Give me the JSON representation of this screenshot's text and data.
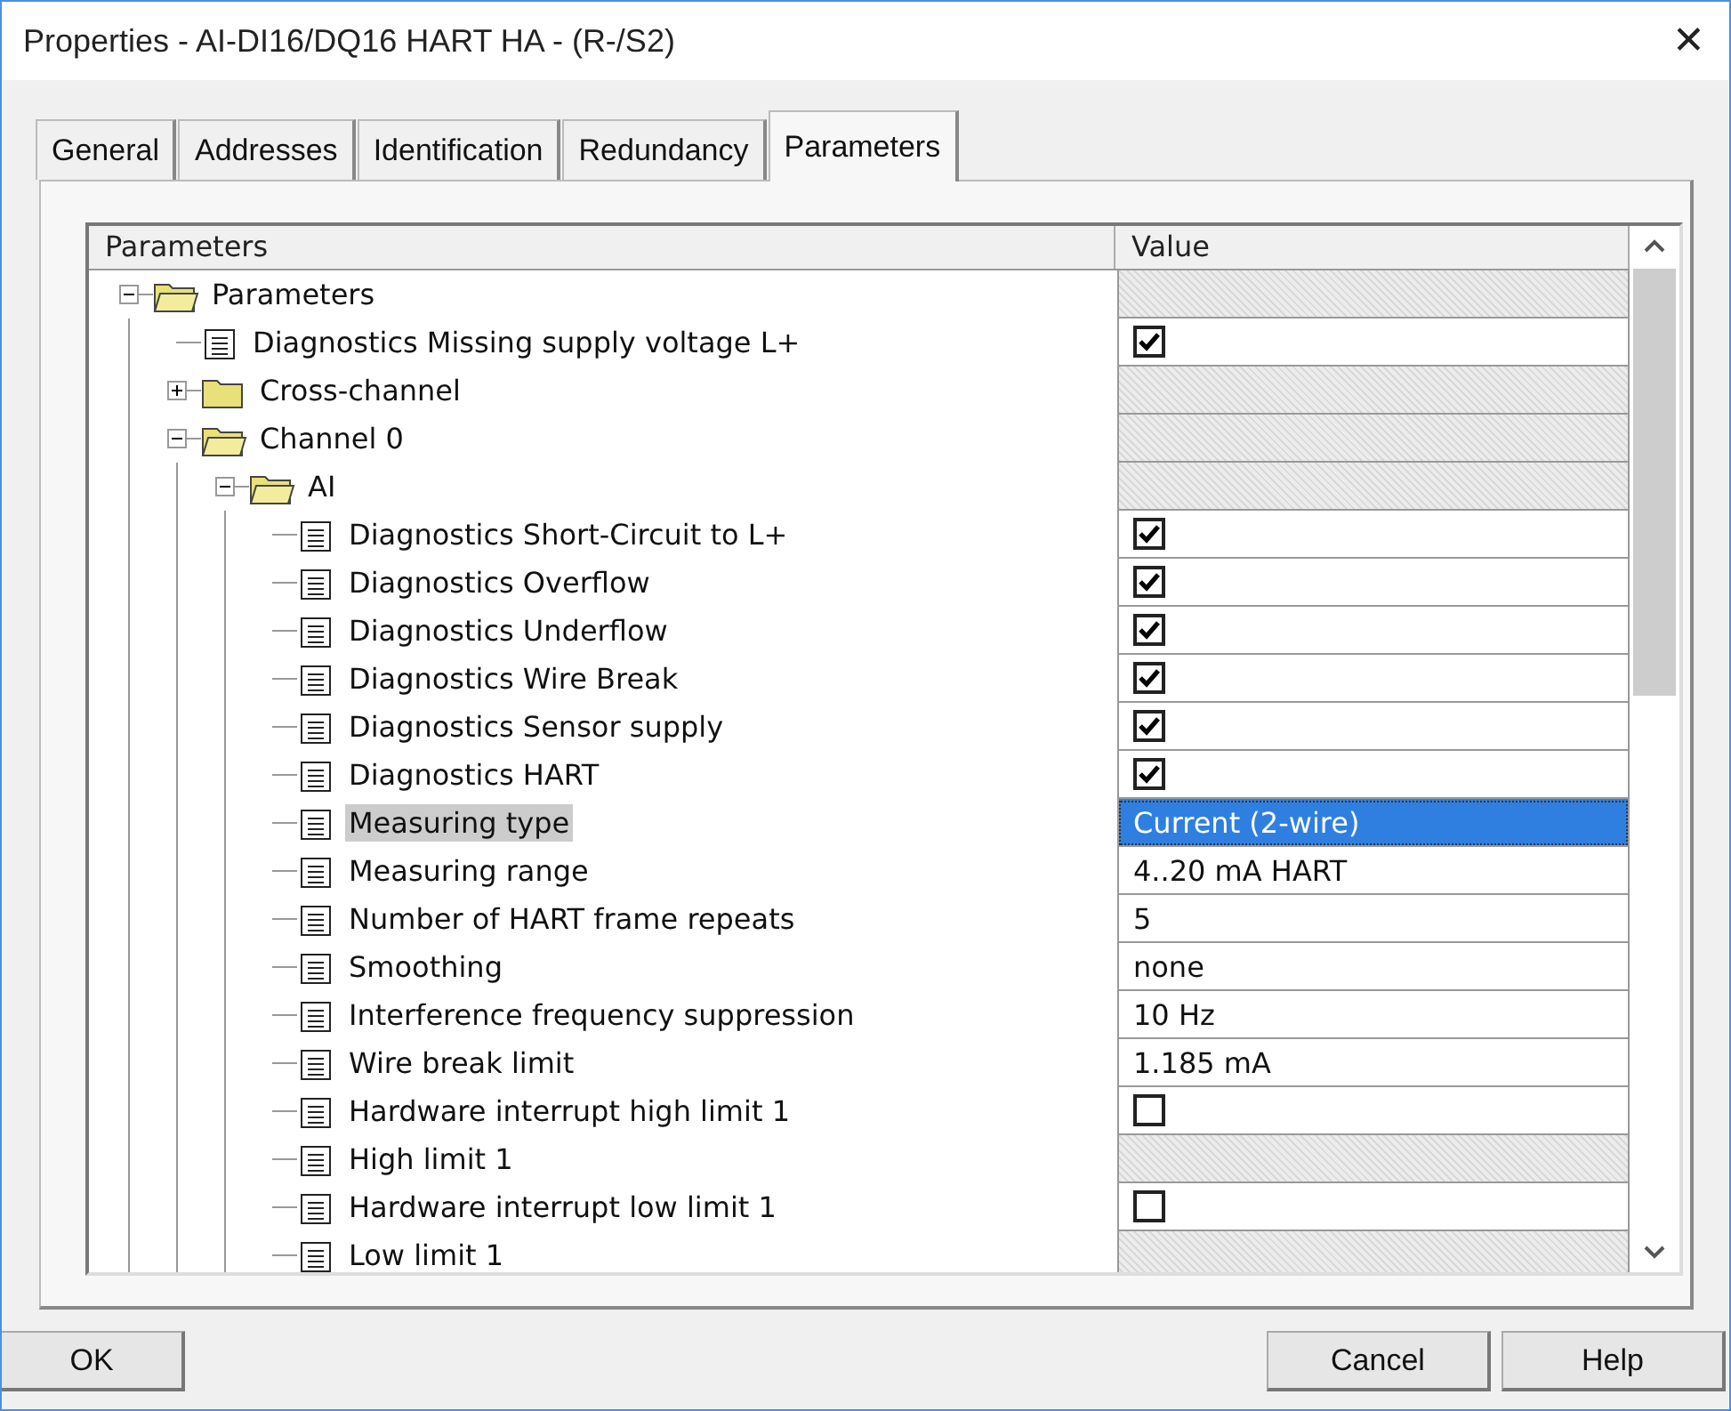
{
  "window": {
    "title": "Properties - AI-DI16/DQ16 HART HA - (R-/S2)",
    "close": "✕"
  },
  "tabs": [
    {
      "label": "General",
      "selected": false
    },
    {
      "label": "Addresses",
      "selected": false
    },
    {
      "label": "Identification",
      "selected": false
    },
    {
      "label": "Redundancy",
      "selected": false
    },
    {
      "label": "Parameters",
      "selected": true
    }
  ],
  "table": {
    "columns": [
      "Parameters",
      "Value"
    ],
    "tree": [
      {
        "label": "Parameters",
        "kind": "folder",
        "expanded": true,
        "selected": false,
        "value": {
          "kind": "none"
        },
        "children": [
          {
            "label": "Diagnostics Missing supply voltage L+",
            "kind": "param",
            "selected": false,
            "value": {
              "kind": "check",
              "checked": true
            }
          },
          {
            "label": "Cross-channel",
            "kind": "folder",
            "expanded": false,
            "selected": false,
            "value": {
              "kind": "none"
            }
          },
          {
            "label": "Channel 0",
            "kind": "folder",
            "expanded": true,
            "selected": false,
            "value": {
              "kind": "none"
            },
            "children": [
              {
                "label": "AI",
                "kind": "folder",
                "expanded": true,
                "selected": false,
                "value": {
                  "kind": "none"
                },
                "children": [
                  {
                    "label": "Diagnostics Short-Circuit to L+",
                    "kind": "param",
                    "selected": false,
                    "value": {
                      "kind": "check",
                      "checked": true
                    }
                  },
                  {
                    "label": "Diagnostics Overflow",
                    "kind": "param",
                    "selected": false,
                    "value": {
                      "kind": "check",
                      "checked": true
                    }
                  },
                  {
                    "label": "Diagnostics Underflow",
                    "kind": "param",
                    "selected": false,
                    "value": {
                      "kind": "check",
                      "checked": true
                    }
                  },
                  {
                    "label": "Diagnostics Wire Break",
                    "kind": "param",
                    "selected": false,
                    "value": {
                      "kind": "check",
                      "checked": true
                    }
                  },
                  {
                    "label": "Diagnostics Sensor supply",
                    "kind": "param",
                    "selected": false,
                    "value": {
                      "kind": "check",
                      "checked": true
                    }
                  },
                  {
                    "label": "Diagnostics HART",
                    "kind": "param",
                    "selected": false,
                    "value": {
                      "kind": "check",
                      "checked": true
                    }
                  },
                  {
                    "label": "Measuring type",
                    "kind": "param",
                    "selected": true,
                    "value": {
                      "kind": "text",
                      "text": "Current (2-wire)"
                    }
                  },
                  {
                    "label": "Measuring range",
                    "kind": "param",
                    "selected": false,
                    "value": {
                      "kind": "text",
                      "text": "4..20 mA HART"
                    }
                  },
                  {
                    "label": "Number of HART frame repeats",
                    "kind": "param",
                    "selected": false,
                    "value": {
                      "kind": "text",
                      "text": "5"
                    }
                  },
                  {
                    "label": "Smoothing",
                    "kind": "param",
                    "selected": false,
                    "value": {
                      "kind": "text",
                      "text": "none"
                    }
                  },
                  {
                    "label": "Interference frequency suppression",
                    "kind": "param",
                    "selected": false,
                    "value": {
                      "kind": "text",
                      "text": "10 Hz"
                    }
                  },
                  {
                    "label": "Wire break limit",
                    "kind": "param",
                    "selected": false,
                    "value": {
                      "kind": "text",
                      "text": "1.185 mA"
                    }
                  },
                  {
                    "label": "Hardware interrupt high limit 1",
                    "kind": "param",
                    "selected": false,
                    "value": {
                      "kind": "check",
                      "checked": false
                    }
                  },
                  {
                    "label": "High limit 1",
                    "kind": "param",
                    "selected": false,
                    "value": {
                      "kind": "none"
                    }
                  },
                  {
                    "label": "Hardware interrupt low limit 1",
                    "kind": "param",
                    "selected": false,
                    "value": {
                      "kind": "check",
                      "checked": false
                    }
                  },
                  {
                    "label": "Low limit 1",
                    "kind": "param",
                    "selected": false,
                    "value": {
                      "kind": "none"
                    }
                  }
                ]
              }
            ]
          }
        ]
      }
    ]
  },
  "buttons": [
    {
      "label": "OK",
      "kind": "ok"
    },
    {
      "label": "Cancel",
      "kind": "cancel"
    },
    {
      "label": "Help",
      "kind": "help"
    }
  ]
}
